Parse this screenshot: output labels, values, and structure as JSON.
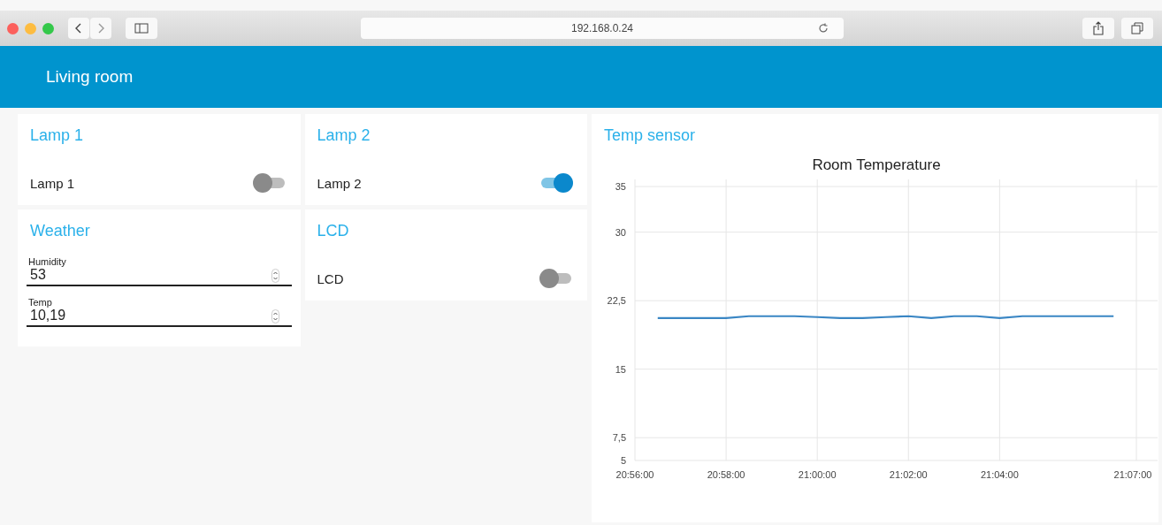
{
  "browser": {
    "address": "192.168.0.24"
  },
  "header": {
    "title": "Living room"
  },
  "columns": [
    {
      "groups": [
        {
          "title": "Lamp 1",
          "items": [
            {
              "kind": "switch",
              "label": "Lamp 1",
              "on": false
            }
          ]
        },
        {
          "title": "Weather",
          "items": [
            {
              "kind": "number",
              "label": "Humidity",
              "value": "53"
            },
            {
              "kind": "number",
              "label": "Temp",
              "value": "10,19"
            }
          ]
        }
      ]
    },
    {
      "groups": [
        {
          "title": "Lamp 2",
          "items": [
            {
              "kind": "switch",
              "label": "Lamp 2",
              "on": true
            }
          ]
        },
        {
          "title": "LCD",
          "items": [
            {
              "kind": "switch",
              "label": "LCD",
              "on": false
            }
          ]
        }
      ]
    }
  ],
  "sensor": {
    "title": "Temp sensor",
    "chart_data": {
      "type": "line",
      "title": "Room Temperature",
      "ylim": [
        5,
        35
      ],
      "grid": true,
      "yticks": [
        5,
        {
          "value": 7.5,
          "label": "7,5"
        },
        15,
        {
          "value": 22.5,
          "label": "22,5"
        },
        30,
        35
      ],
      "categories": [
        "20:56:00",
        null,
        null,
        null,
        "20:58:00",
        null,
        null,
        null,
        "21:00:00",
        null,
        null,
        null,
        "21:02:00",
        null,
        null,
        null,
        "21:04:00",
        null,
        null,
        null,
        null,
        null,
        "21:07:00"
      ],
      "series": [
        {
          "color": "#3a86c4",
          "values": [
            null,
            20.6,
            20.6,
            20.6,
            20.6,
            20.8,
            20.8,
            20.8,
            20.7,
            20.6,
            20.6,
            20.7,
            20.8,
            20.6,
            20.8,
            20.8,
            20.6,
            20.8,
            20.8,
            20.8,
            20.8,
            20.8,
            null
          ]
        }
      ]
    }
  }
}
